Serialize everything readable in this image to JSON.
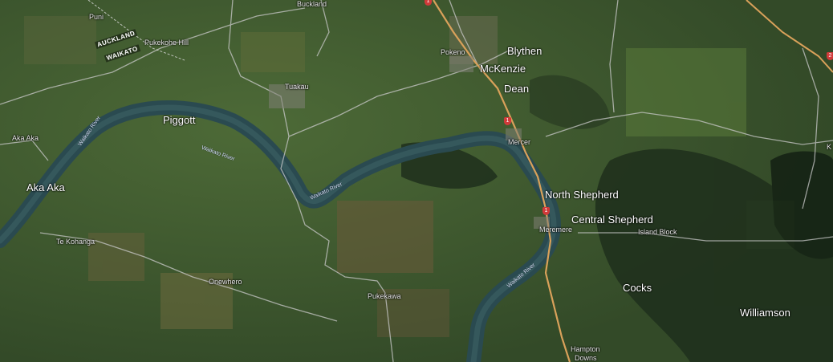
{
  "map": {
    "type": "satellite",
    "towns": [
      {
        "key": "puni",
        "name": "Puni"
      },
      {
        "key": "buckland",
        "name": "Buckland"
      },
      {
        "key": "pukekohe_hill",
        "name": "Pukekohe Hill"
      },
      {
        "key": "pokeno",
        "name": "Pokeno"
      },
      {
        "key": "tuakau",
        "name": "Tuakau"
      },
      {
        "key": "aka_aka_small",
        "name": "Aka Aka"
      },
      {
        "key": "mercer",
        "name": "Mercer"
      },
      {
        "key": "meremere",
        "name": "Meremere"
      },
      {
        "key": "island_block",
        "name": "Island Block"
      },
      {
        "key": "te_kohanga",
        "name": "Te Kohanga"
      },
      {
        "key": "onewhero",
        "name": "Onewhero"
      },
      {
        "key": "pukekawa",
        "name": "Pukekawa"
      },
      {
        "key": "hampton",
        "name": "Hampton"
      },
      {
        "key": "downs",
        "name": "Downs"
      },
      {
        "key": "edge_k",
        "name": "K"
      }
    ],
    "regions": [
      "AUCKLAND",
      "WAIKATO"
    ],
    "river_name": "Waikato River",
    "overlay_labels": [
      {
        "key": "blythen",
        "text": "Blythen"
      },
      {
        "key": "mckenzie",
        "text": "McKenzie"
      },
      {
        "key": "dean",
        "text": "Dean"
      },
      {
        "key": "piggott",
        "text": "Piggott"
      },
      {
        "key": "aka_aka",
        "text": "Aka Aka"
      },
      {
        "key": "north_shepherd",
        "text": "North Shepherd"
      },
      {
        "key": "central_shepherd",
        "text": "Central Shepherd"
      },
      {
        "key": "cocks",
        "text": "Cocks"
      },
      {
        "key": "williamson",
        "text": "Williamson"
      }
    ],
    "highway_shields": [
      "1",
      "1",
      "1",
      "2"
    ],
    "colors": {
      "terrain": "#3f5a2f",
      "dark_vegetation": "#1e2d1a",
      "river": "#2a4a50",
      "road_highway": "#d9a15a",
      "road_minor": "#c9c9c9"
    }
  }
}
